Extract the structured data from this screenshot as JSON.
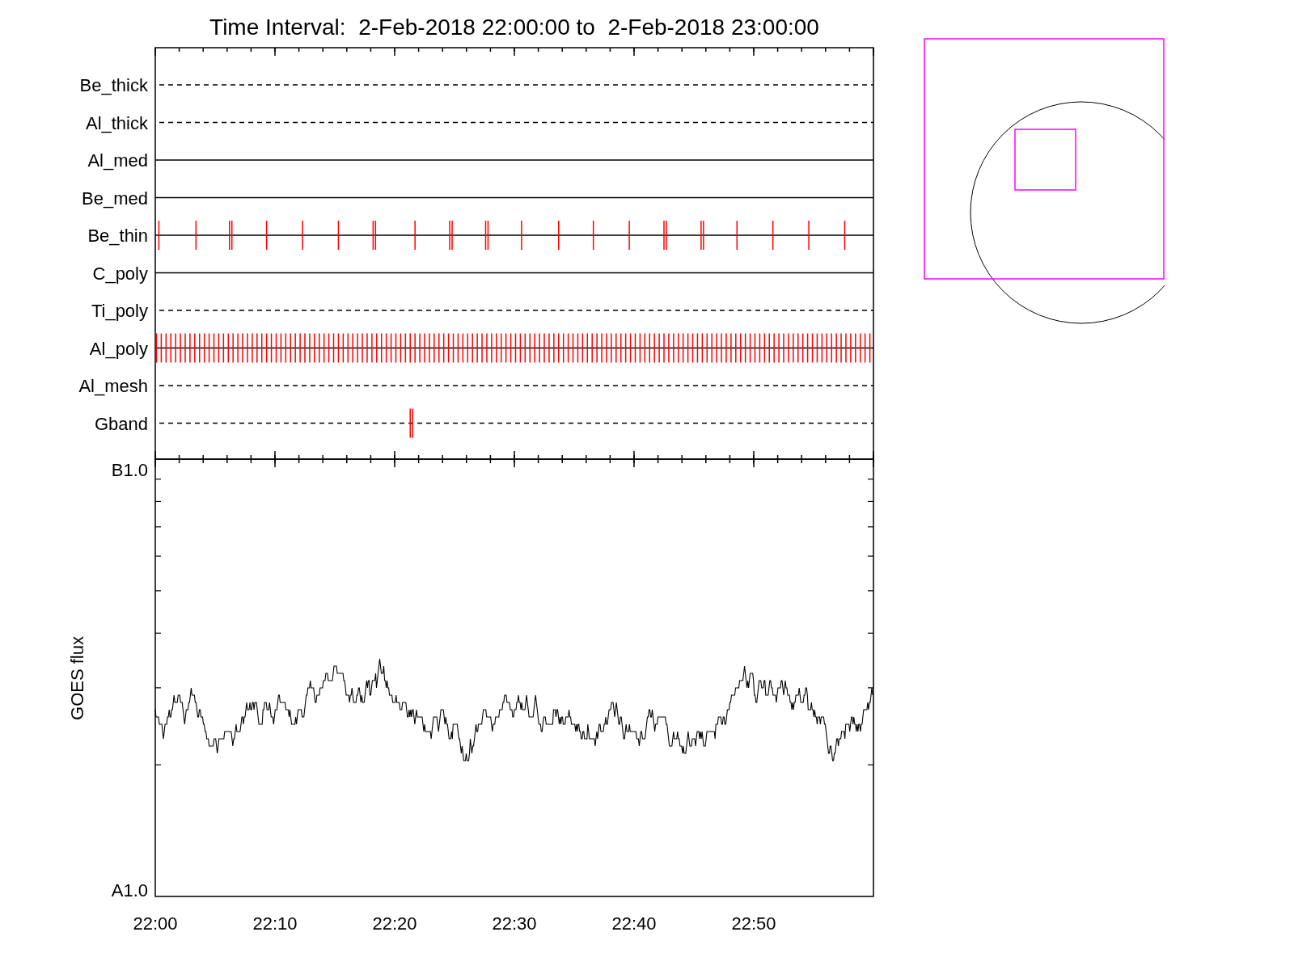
{
  "title": "Time Interval:  2-Feb-2018 22:00:00 to  2-Feb-2018 23:00:00",
  "filters": [
    {
      "name": "Be_thick",
      "kind": "dashed"
    },
    {
      "name": "Al_thick",
      "kind": "dashed"
    },
    {
      "name": "Al_med",
      "kind": "solid"
    },
    {
      "name": "Be_med",
      "kind": "solid"
    },
    {
      "name": "Be_thin",
      "kind": "solid",
      "exposures": {
        "kind": "periodic"
      }
    },
    {
      "name": "C_poly",
      "kind": "solid"
    },
    {
      "name": "Ti_poly",
      "kind": "dashed"
    },
    {
      "name": "Al_poly",
      "kind": "solid",
      "exposures": {
        "kind": "dense"
      }
    },
    {
      "name": "Al_mesh",
      "kind": "dashed"
    },
    {
      "name": "Gband",
      "kind": "dashed",
      "exposures": {
        "kind": "pair"
      }
    }
  ],
  "goes_panel": {
    "ylabel": "GOES flux",
    "y_top": "B1.0",
    "y_bottom": "A1.0",
    "x_labels": [
      "22:00",
      "22:10",
      "22:20",
      "22:30",
      "22:40",
      "22:50"
    ]
  }
}
